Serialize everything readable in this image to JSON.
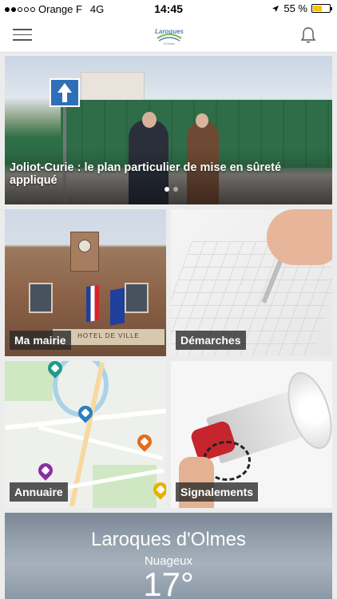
{
  "status_bar": {
    "carrier": "Orange F",
    "network": "4G",
    "time": "14:45",
    "battery": "55 %",
    "battery_level": 0.55,
    "signal_bars_filled": 2,
    "signal_bars_total": 5,
    "location_icon": "location-arrow-icon"
  },
  "header": {
    "menu_icon": "hamburger-menu-icon",
    "logo_text": "Laroques",
    "logo_subtext": "d'Olmes",
    "notification_icon": "bell-icon"
  },
  "hero": {
    "title": "Joliot-Curie : le plan particulier de mise en sûreté appliqué",
    "carousel_count": 2,
    "carousel_active": 1
  },
  "tiles": {
    "mairie": {
      "label": "Ma mairie",
      "plaque": "HOTEL DE VILLE"
    },
    "demarches": {
      "label": "Démarches"
    },
    "annuaire": {
      "label": "Annuaire"
    },
    "signalements": {
      "label": "Signalements"
    }
  },
  "weather": {
    "city": "Laroques d'Olmes",
    "condition": "Nuageux",
    "temperature": "17°"
  },
  "colors": {
    "label_bg": "#282828",
    "battery": "#f5c400",
    "pin_teal": "#1f9a8a",
    "pin_blue": "#2a7fc1",
    "pin_orange": "#e46b1f",
    "pin_purple": "#8a2f9e",
    "pin_yellow": "#e9b000"
  }
}
